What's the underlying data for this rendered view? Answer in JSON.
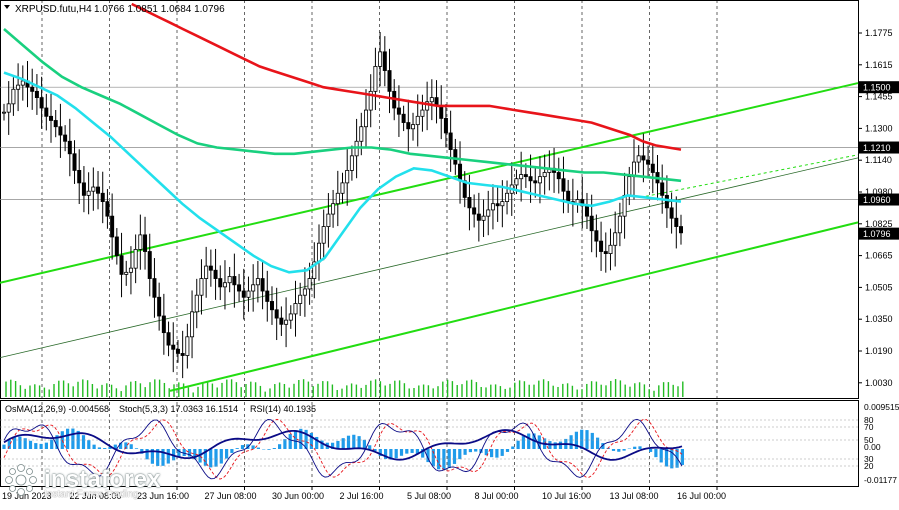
{
  "header": {
    "symbol": "XRPUSD.futu,H4",
    "ohlc": "1.0766 1.0851 1.0684 1.0796"
  },
  "colors": {
    "candle": "#000000",
    "grid": "#000000",
    "ma_red": "#e8141a",
    "ma_green": "#19d07f",
    "ma_cyan": "#22e0ec",
    "channel": "#22dd11",
    "osma": "#1f9bea",
    "stoch_main": "#0b0b86",
    "stoch_signal": "#e8141a",
    "rsi": "#0b0b86",
    "volume": "#22bb22",
    "price_label_bg": "#000000",
    "price_label_text": "#ffffff"
  },
  "chart_data": [
    {
      "type": "candlestick",
      "title": "XRPUSD.futu,H4",
      "y_axis": {
        "ylim": [
          1.0025,
          1.19
        ],
        "ticks": [
          "1.1775",
          "1.1615",
          "1.1455",
          "1.1300",
          "1.1140",
          "1.0980",
          "1.0825",
          "1.0665",
          "1.0505",
          "1.0350",
          "1.0190",
          "1.0030"
        ]
      },
      "x_axis": {
        "ticks": [
          "19 Jun 2023",
          "22 Jun 08:00",
          "23 Jun 16:00",
          "27 Jun 08:00",
          "30 Jun 00:00",
          "2 Jul 16:00",
          "5 Jul 08:00",
          "8 Jul 00:00",
          "10 Jul 16:00",
          "13 Jul 08:00",
          "16 Jul 00:00"
        ]
      },
      "price_labels": [
        {
          "text": "1.1500",
          "value": 1.15
        },
        {
          "text": "1.1210",
          "value": 1.121
        },
        {
          "text": "1.0960",
          "value": 1.096
        },
        {
          "text": "1.0796",
          "value": 1.0796
        }
      ],
      "ohlc_close_path": [
        1.138,
        1.142,
        1.149,
        1.151,
        1.153,
        1.15,
        1.148,
        1.145,
        1.14,
        1.136,
        1.134,
        1.131,
        1.127,
        1.124,
        1.118,
        1.11,
        1.104,
        1.098,
        1.1,
        1.102,
        1.099,
        1.095,
        1.088,
        1.078,
        1.069,
        1.06,
        1.061,
        1.063,
        1.072,
        1.079,
        1.071,
        1.058,
        1.049,
        1.04,
        1.032,
        1.026,
        1.024,
        1.022,
        1.021,
        1.03,
        1.042,
        1.05,
        1.058,
        1.064,
        1.062,
        1.058,
        1.054,
        1.056,
        1.059,
        1.055,
        1.052,
        1.049,
        1.052,
        1.055,
        1.058,
        1.052,
        1.047,
        1.043,
        1.039,
        1.036,
        1.038,
        1.041,
        1.046,
        1.05,
        1.053,
        1.058,
        1.066,
        1.075,
        1.083,
        1.089,
        1.094,
        1.099,
        1.104,
        1.11,
        1.117,
        1.124,
        1.131,
        1.139,
        1.148,
        1.16,
        1.167,
        1.158,
        1.148,
        1.14,
        1.137,
        1.133,
        1.13,
        1.132,
        1.136,
        1.139,
        1.143,
        1.145,
        1.141,
        1.135,
        1.128,
        1.12,
        1.113,
        1.105,
        1.097,
        1.092,
        1.089,
        1.086,
        1.088,
        1.091,
        1.094,
        1.093,
        1.095,
        1.099,
        1.103,
        1.106,
        1.108,
        1.107,
        1.105,
        1.104,
        1.107,
        1.109,
        1.111,
        1.109,
        1.106,
        1.1,
        1.095,
        1.094,
        1.096,
        1.093,
        1.088,
        1.081,
        1.076,
        1.071,
        1.07,
        1.074,
        1.08,
        1.088,
        1.098,
        1.107,
        1.114,
        1.117,
        1.115,
        1.113,
        1.109,
        1.104,
        1.098,
        1.092,
        1.087,
        1.083,
        1.08
      ],
      "moving_averages": [
        {
          "color": "red",
          "values": [
            null,
            null,
            null,
            null,
            null,
            null,
            null,
            null,
            null,
            null,
            1.19,
            1.187,
            1.184,
            1.181,
            1.178,
            1.175,
            1.172,
            1.169,
            1.166,
            1.163,
            1.16,
            1.158,
            1.156,
            1.154,
            1.152,
            1.15,
            1.149,
            1.148,
            1.147,
            1.146,
            1.145,
            1.144,
            1.143,
            1.142,
            1.141,
            1.141,
            1.141,
            1.141,
            1.141,
            1.14,
            1.139,
            1.138,
            1.137,
            1.136,
            1.135,
            1.134,
            1.133,
            1.131,
            1.129,
            1.127,
            1.124,
            1.122,
            1.121,
            1.12
          ]
        },
        {
          "color": "green",
          "values": [
            1.178,
            1.17,
            1.162,
            1.155,
            1.15,
            1.146,
            1.142,
            1.137,
            1.132,
            1.127,
            1.123,
            1.121,
            1.12,
            1.119,
            1.118,
            1.118,
            1.119,
            1.12,
            1.121,
            1.121,
            1.12,
            1.118,
            1.117,
            1.116,
            1.115,
            1.114,
            1.113,
            1.112,
            1.111,
            1.11,
            1.109,
            1.109,
            1.108,
            1.107,
            1.106,
            1.105
          ]
        },
        {
          "color": "cyan",
          "values": [
            1.157,
            1.154,
            1.15,
            1.146,
            1.14,
            1.133,
            1.126,
            1.118,
            1.11,
            1.102,
            1.094,
            1.087,
            1.081,
            1.075,
            1.069,
            1.064,
            1.061,
            1.062,
            1.068,
            1.08,
            1.092,
            1.101,
            1.107,
            1.111,
            1.11,
            1.107,
            1.104,
            1.103,
            1.102,
            1.1,
            1.098,
            1.096,
            1.094,
            1.093,
            1.095,
            1.098,
            1.097,
            1.096,
            1.095
          ]
        }
      ]
    },
    {
      "type": "oscillator",
      "labels": {
        "osma": "OsMA(12,26,9) -0.004568",
        "stoch": "Stoch(5,3,3) 17.0363 16.1514",
        "rsi": "RSI(14) 40.1935"
      },
      "y_axis": {
        "ticks": [
          "0.009515",
          "80",
          "70",
          "50",
          "0.00",
          "30",
          "20",
          "-0.01177"
        ]
      }
    }
  ],
  "watermark": {
    "brand": "instaforex",
    "tagline": "Instant Forex Trading"
  }
}
